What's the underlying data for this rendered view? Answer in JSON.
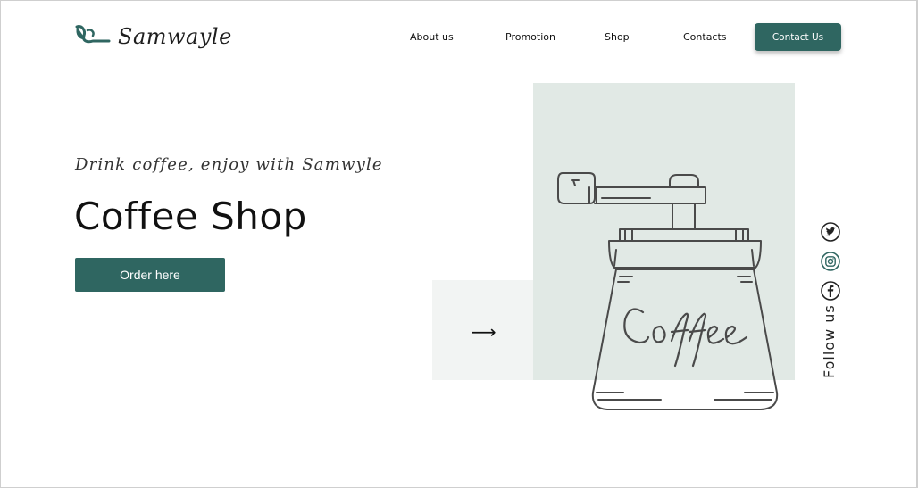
{
  "brand": {
    "name": "Samwayle",
    "accent": "#2f6661"
  },
  "nav": {
    "items": [
      {
        "label": "About us"
      },
      {
        "label": "Promotion"
      },
      {
        "label": "Shop"
      },
      {
        "label": "Contacts"
      }
    ],
    "cta_label": "Contact Us"
  },
  "hero": {
    "tagline": "Drink coffee, enjoy with Samwyle",
    "title": "Coffee Shop",
    "order_label": "Order here",
    "next_arrow": "⟶",
    "grinder_text": "Coffee"
  },
  "social": {
    "icons": [
      "twitter-icon",
      "instagram-icon",
      "facebook-icon"
    ],
    "follow_label": "Follow us"
  }
}
